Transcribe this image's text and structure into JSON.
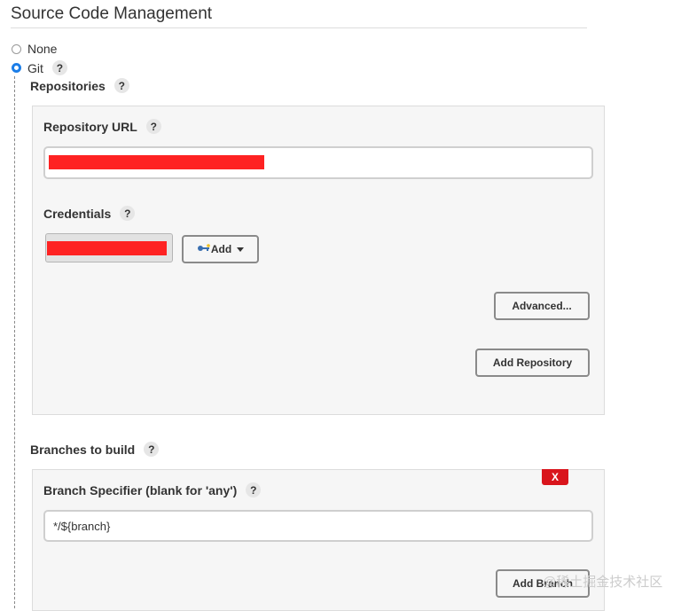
{
  "section": {
    "title": "Source Code Management"
  },
  "scm_options": [
    {
      "label": "None",
      "selected": false
    },
    {
      "label": "Git",
      "selected": true
    }
  ],
  "help_glyph": "?",
  "repositories": {
    "label": "Repositories",
    "repository_url_label": "Repository URL",
    "credentials_label": "Credentials",
    "add_button_label": "Add",
    "advanced_button_label": "Advanced...",
    "add_repository_button_label": "Add Repository"
  },
  "branches": {
    "label": "Branches to build",
    "specifier_label": "Branch Specifier (blank for 'any')",
    "specifier_value": "*/${branch}",
    "delete_label": "X",
    "add_branch_button_label": "Add Branch"
  },
  "watermark": {
    "text": "@稀土掘金技术社区"
  },
  "colors": {
    "accent": "#1c7ee8",
    "danger": "#d9151c",
    "redaction": "#fe2222"
  }
}
